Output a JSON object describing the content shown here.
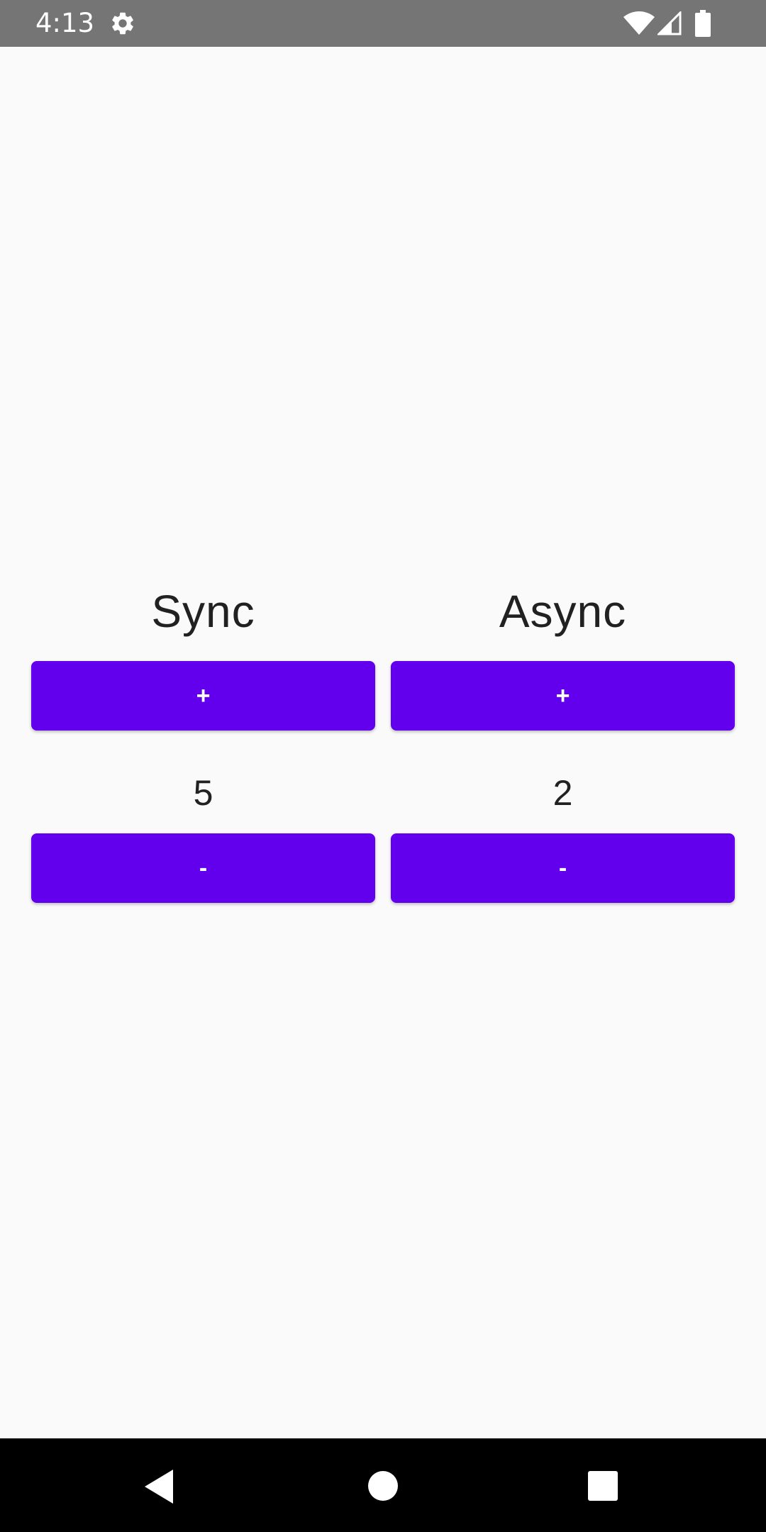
{
  "status_bar": {
    "time": "4:13",
    "icons": [
      "settings-icon",
      "wifi-icon",
      "signal-icon",
      "battery-icon"
    ],
    "background": "#757575"
  },
  "sync": {
    "title": "Sync",
    "plus_label": "+",
    "value": "5",
    "minus_label": "-"
  },
  "async": {
    "title": "Async",
    "plus_label": "+",
    "value": "2",
    "minus_label": "-"
  },
  "nav_bar": {
    "icons": [
      "back-icon",
      "home-icon",
      "recents-icon"
    ]
  },
  "colors": {
    "accent": "#6200ee",
    "background": "#fafafa",
    "text": "#212121"
  }
}
